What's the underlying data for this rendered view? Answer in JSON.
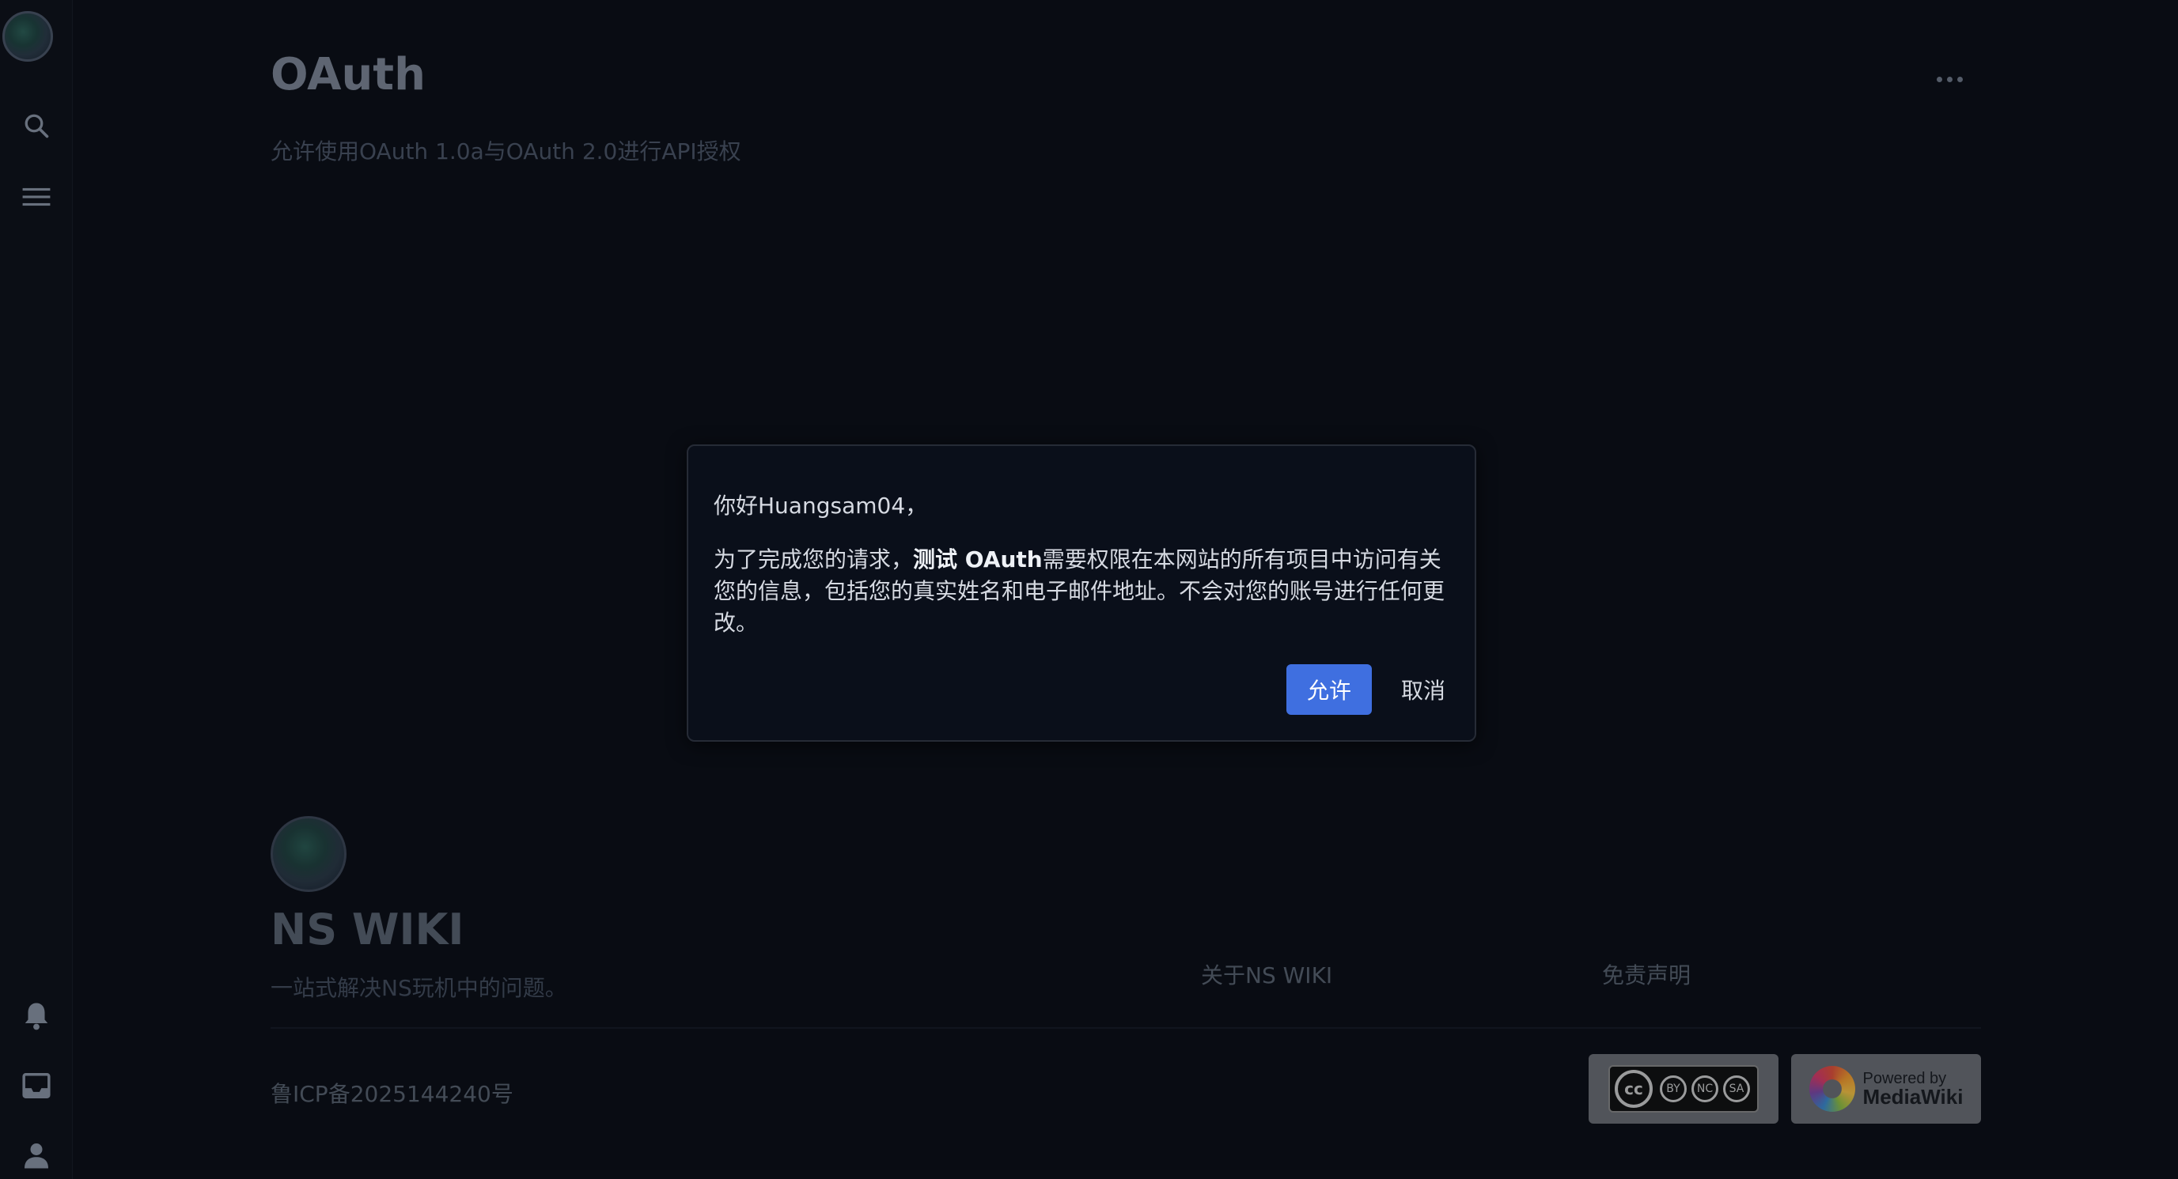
{
  "page": {
    "title": "OAuth",
    "subtitle": "允许使用OAuth 1.0a与OAuth 2.0进行API授权",
    "more_icon": "more-horizontal-icon"
  },
  "sidebar": {
    "top_items": [
      {
        "icon": "search-icon"
      },
      {
        "icon": "menu-icon"
      }
    ],
    "bottom_items": [
      {
        "icon": "bell-icon"
      },
      {
        "icon": "inbox-icon"
      },
      {
        "icon": "user-icon"
      }
    ]
  },
  "dialog": {
    "greeting": "你好Huangsam04，",
    "body_prefix": "为了完成您的请求，",
    "app_name": "测试 OAuth",
    "body_suffix": "需要权限在本网站的所有项目中访问有关您的信息，包括您的真实姓名和电子邮件地址。不会对您的账号进行任何更改。",
    "allow_label": "允许",
    "cancel_label": "取消",
    "allow_color": "#3f6fe0"
  },
  "footer": {
    "site_name": "NS WIKI",
    "tagline": "一站式解决NS玩机中的问题。",
    "links": [
      "关于NS WIKI",
      "免责声明"
    ],
    "icp": "鲁ICP备2025144240号",
    "cc_badge": {
      "labels": [
        "BY",
        "NC",
        "SA"
      ]
    },
    "mw_badge": {
      "line1": "Powered by",
      "line2": "MediaWiki"
    }
  }
}
